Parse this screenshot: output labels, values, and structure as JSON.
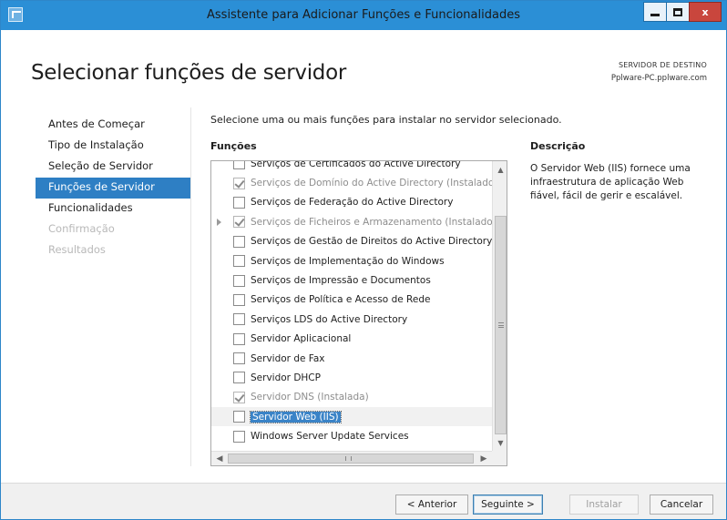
{
  "window": {
    "title": "Assistente para Adicionar Funções e Funcionalidades",
    "minimize_icon": "minimize-icon",
    "maximize_icon": "maximize-icon",
    "close_label": "x"
  },
  "page": {
    "title": "Selecionar funções de servidor",
    "destination_label": "SERVIDOR DE DESTINO",
    "destination_server": "Pplware-PC.pplware.com"
  },
  "nav": {
    "items": [
      {
        "label": "Antes de Começar",
        "state": "normal"
      },
      {
        "label": "Tipo de Instalação",
        "state": "normal"
      },
      {
        "label": "Seleção de Servidor",
        "state": "normal"
      },
      {
        "label": "Funções de Servidor",
        "state": "active"
      },
      {
        "label": "Funcionalidades",
        "state": "normal"
      },
      {
        "label": "Confirmação",
        "state": "disabled"
      },
      {
        "label": "Resultados",
        "state": "disabled"
      }
    ]
  },
  "main": {
    "instruction": "Selecione uma ou mais funções para instalar no servidor selecionado.",
    "roles_header": "Funções",
    "description_header": "Descrição",
    "description_text": "O Servidor Web (IIS) fornece uma infraestrutura de aplicação Web fiável, fácil de gerir e escalável."
  },
  "roles": [
    {
      "label": "Serviços de Certificados do Active Directory",
      "checked": false,
      "grayed": false,
      "expander": false
    },
    {
      "label": "Serviços de Domínio do Active Directory (Instalado)",
      "checked": true,
      "grayed": true,
      "expander": false
    },
    {
      "label": "Serviços de Federação do Active Directory",
      "checked": false,
      "grayed": false,
      "expander": false
    },
    {
      "label": "Serviços de Ficheiros e Armazenamento (Instalado)",
      "checked": true,
      "grayed": true,
      "expander": true
    },
    {
      "label": "Serviços de Gestão de Direitos do Active Directory",
      "checked": false,
      "grayed": false,
      "expander": false
    },
    {
      "label": "Serviços de Implementação do Windows",
      "checked": false,
      "grayed": false,
      "expander": false
    },
    {
      "label": "Serviços de Impressão e Documentos",
      "checked": false,
      "grayed": false,
      "expander": false
    },
    {
      "label": "Serviços de Política e Acesso de Rede",
      "checked": false,
      "grayed": false,
      "expander": false
    },
    {
      "label": "Serviços LDS do Active Directory",
      "checked": false,
      "grayed": false,
      "expander": false
    },
    {
      "label": "Servidor Aplicacional",
      "checked": false,
      "grayed": false,
      "expander": false
    },
    {
      "label": "Servidor de Fax",
      "checked": false,
      "grayed": false,
      "expander": false
    },
    {
      "label": "Servidor DHCP",
      "checked": false,
      "grayed": false,
      "expander": false
    },
    {
      "label": "Servidor DNS (Instalada)",
      "checked": true,
      "grayed": true,
      "expander": false
    },
    {
      "label": "Servidor Web (IIS)",
      "checked": false,
      "grayed": false,
      "expander": false,
      "selected": true
    },
    {
      "label": "Windows Server Update Services",
      "checked": false,
      "grayed": false,
      "expander": false
    }
  ],
  "footer": {
    "prev_label": "< Anterior",
    "next_label": "Seguinte >",
    "install_label": "Instalar",
    "cancel_label": "Cancelar"
  },
  "colors": {
    "titlebar": "#2b8fd6",
    "nav_active": "#2e7fc4",
    "close_button": "#c9463d"
  }
}
